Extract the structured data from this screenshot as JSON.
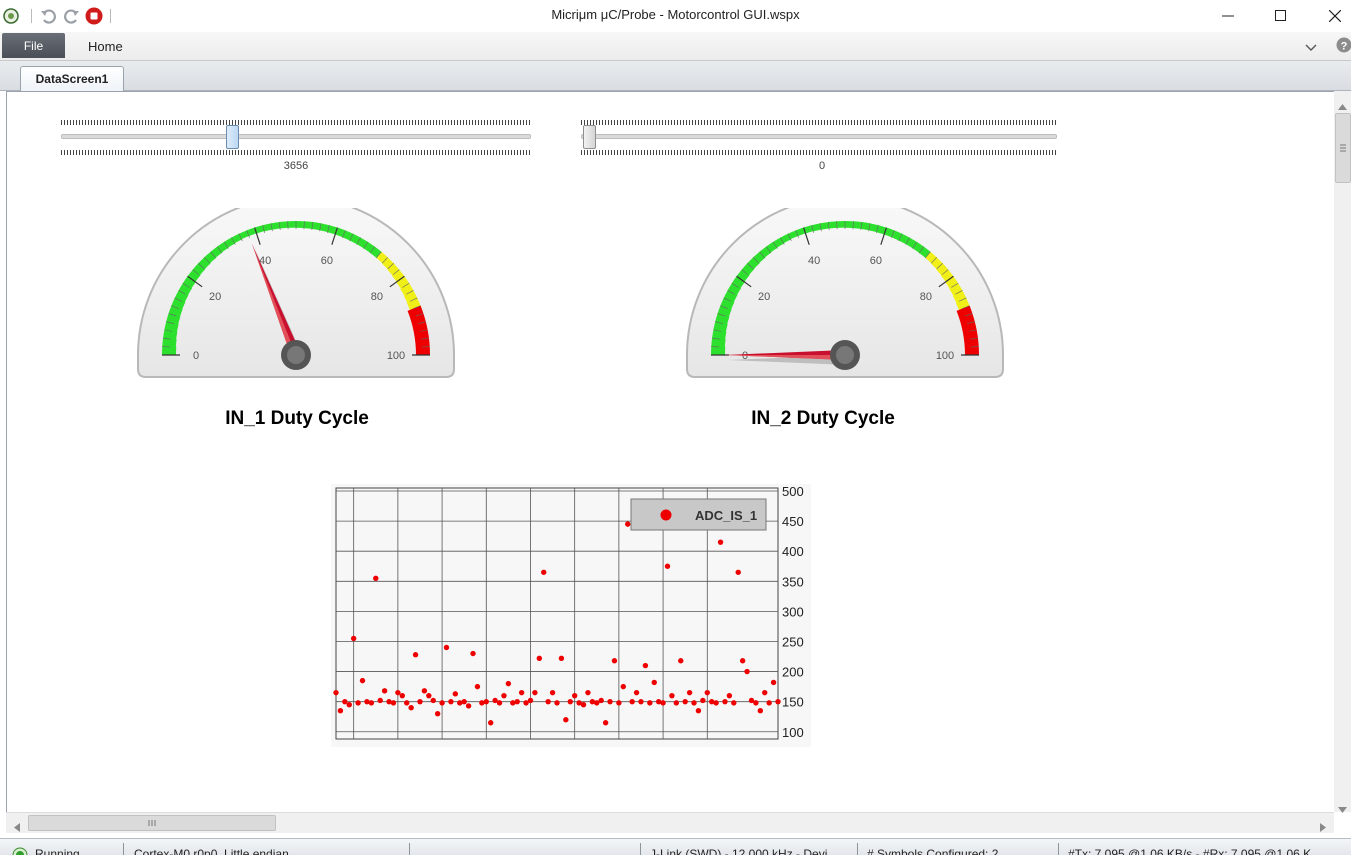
{
  "window": {
    "title": "Micriμm μC/Probe - Motorcontrol GUI.wspx",
    "controls": [
      "minimize-icon",
      "maximize-icon",
      "close-icon"
    ]
  },
  "quick_access": [
    "probe-logo-icon",
    "undo-icon",
    "redo-icon",
    "stop-icon"
  ],
  "ribbon": {
    "file_label": "File",
    "home_label": "Home"
  },
  "tabs": [
    {
      "label": "DataScreen1",
      "active": true
    }
  ],
  "sliders": [
    {
      "value_label": "3656",
      "value": 3656
    },
    {
      "value_label": "0",
      "value": 0
    }
  ],
  "gauges": [
    {
      "title": "IN_1 Duty Cycle",
      "needle_value": 38,
      "tick_labels": [
        "0",
        "20",
        "40",
        "60",
        "80",
        "100"
      ],
      "zones": {
        "green": "#2ee02e",
        "yellow": "#f0f018",
        "red": "#ee0000"
      }
    },
    {
      "title": "IN_2 Duty Cycle",
      "needle_value": 0,
      "tick_labels": [
        "0",
        "20",
        "40",
        "60",
        "80",
        "100"
      ],
      "zones": {
        "green": "#2ee02e",
        "yellow": "#f0f018",
        "red": "#ee0000"
      }
    }
  ],
  "chart_data": {
    "type": "scatter",
    "series": [
      {
        "name": "ADC_IS_1",
        "color": "#ee0000",
        "x": [
          0,
          1,
          2,
          3,
          4,
          5,
          6,
          7,
          8,
          9,
          10,
          11,
          12,
          13,
          14,
          15,
          16,
          17,
          18,
          19,
          20,
          21,
          22,
          23,
          24,
          25,
          26,
          27,
          28,
          29,
          30,
          31,
          32,
          33,
          34,
          35,
          36,
          37,
          38,
          39,
          40,
          41,
          42,
          43,
          44,
          45,
          46,
          47,
          48,
          49,
          50,
          51,
          52,
          53,
          54,
          55,
          56,
          57,
          58,
          59,
          60,
          61,
          62,
          63,
          64,
          65,
          66,
          67,
          68,
          69,
          70,
          71,
          72,
          73,
          74,
          75,
          76,
          77,
          78,
          79,
          80,
          81,
          82,
          83,
          84,
          85,
          86,
          87,
          88,
          89,
          90,
          91,
          92,
          93,
          94,
          95,
          96,
          97,
          98,
          99,
          100
        ],
        "y": [
          165,
          135,
          150,
          145,
          255,
          148,
          185,
          150,
          148,
          355,
          152,
          168,
          150,
          148,
          165,
          160,
          148,
          140,
          228,
          150,
          168,
          160,
          152,
          130,
          148,
          240,
          150,
          163,
          148,
          150,
          143,
          230,
          175,
          148,
          150,
          115,
          152,
          148,
          160,
          180,
          148,
          150,
          165,
          148,
          152,
          165,
          222,
          365,
          150,
          165,
          148,
          222,
          120,
          150,
          160,
          148,
          145,
          165,
          150,
          148,
          152,
          115,
          150,
          218,
          148,
          175,
          445,
          150,
          165,
          150,
          210,
          148,
          182,
          150,
          148,
          375,
          160,
          148,
          218,
          150,
          165,
          148,
          135,
          152,
          165,
          150,
          148,
          415,
          150,
          160,
          148,
          365,
          218,
          200,
          152,
          148,
          135,
          165,
          148,
          182,
          150
        ],
        "marker": "circle"
      }
    ],
    "y_ticks": [
      "100",
      "150",
      "200",
      "250",
      "300",
      "350",
      "400",
      "450",
      "500"
    ],
    "ylim": [
      88,
      505
    ],
    "xlim": [
      0,
      100
    ],
    "grid": true,
    "legend_position": "top-right"
  },
  "status": {
    "state": "Running",
    "cpu": "Cortex-M0 r0p0, Little endian",
    "link": "J-Link (SWD) - 12,000 kHz - Devi",
    "symbols": "# Symbols Configured: 2",
    "traffic": "#Tx: 7,095 @1.06 KB/s - #Rx: 7,095 @1.06 K"
  }
}
